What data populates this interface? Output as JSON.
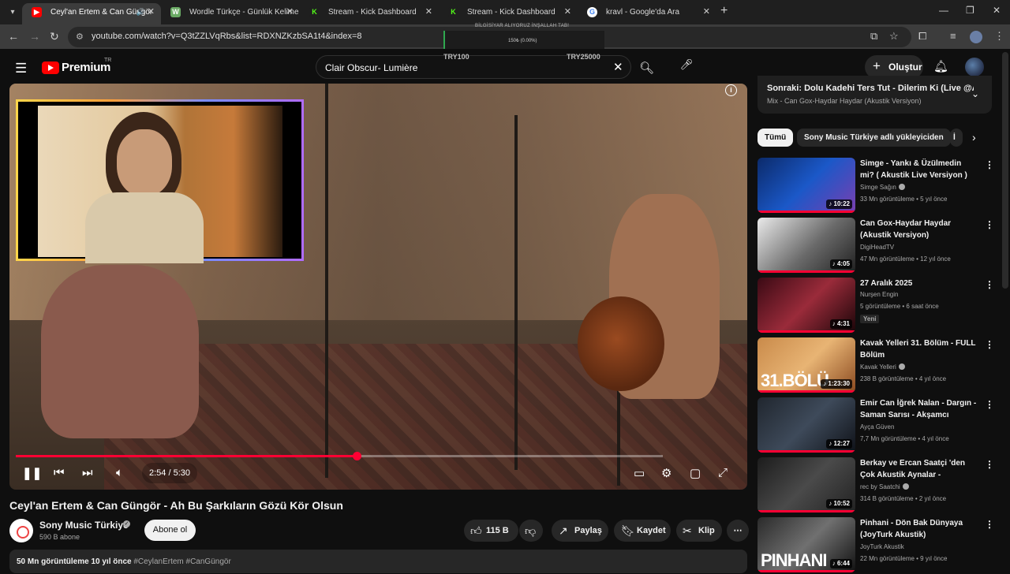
{
  "browser": {
    "tabs": [
      {
        "label": "Ceyl'an Ertem & Can Güngör",
        "favicon": "youtube-icon",
        "active": true
      },
      {
        "label": "Wordle Türkçe - Günlük Kelime",
        "favicon": "wordle-icon",
        "active": false
      },
      {
        "label": "Stream - Kick Dashboard",
        "favicon": "kick-icon",
        "active": false
      },
      {
        "label": "Stream - Kick Dashboard",
        "favicon": "kick-icon",
        "active": false
      },
      {
        "label": "kravl - Google'da Ara",
        "favicon": "google-icon",
        "active": false
      }
    ],
    "url": "youtube.com/watch?v=Q3tZZLVqRbs&list=RDXNZKzbSA1t4&index=8"
  },
  "stream_overlay": {
    "title": "BİLGİSİYAR ALIYORUZ İNŞALLAH TAB!",
    "progress_text": "150₺ (0.00%)",
    "progress": 0.0,
    "min_label": "TRY100",
    "max_label": "TRY25000"
  },
  "header": {
    "logo_text": "Premium",
    "logo_region": "TR",
    "search_value": "Clair Obscur- Lumière",
    "create_label": "Oluştur"
  },
  "player": {
    "time_text": "2:54 / 5:30",
    "progress": 0.527
  },
  "video": {
    "title": "Ceyl'an Ertem & Can Güngör - Ah Bu Şarkıların Gözü Kör Olsun",
    "channel": "Sony Music Türkiye",
    "subscribers": "590 B abone",
    "subscribe_label": "Abone ol",
    "likes": "115 B",
    "share_label": "Paylaş",
    "save_label": "Kaydet",
    "clip_label": "Klip",
    "desc_stats": "50 Mn görüntüleme  10 yıl önce",
    "desc_tags": "#CeylanErtem #CanGüngör"
  },
  "sidebar": {
    "next_title": "Sonraki: Dolu Kadehi Ters Tut - Dilerim Ki (Live @As...",
    "next_sub": "Mix - Can Gox-Haydar Haydar (Akustik Versiyon)",
    "chips": [
      "Tümü",
      "Sony Music Türkiye adlı yükleyiciden",
      "İ"
    ],
    "recommendations": [
      {
        "title": "Simge - Yankı & Üzülmedin mi? ( Akustik Live Versiyon )",
        "channel": "Simge Sağın",
        "verified": true,
        "meta": "33 Mn görüntüleme • 5 yıl önce",
        "duration": "10:22",
        "badge": ""
      },
      {
        "title": "Can Gox-Haydar Haydar (Akustik Versiyon)",
        "channel": "DigiHeadTV",
        "verified": false,
        "meta": "47 Mn görüntüleme • 12 yıl önce",
        "duration": "4:05",
        "badge": ""
      },
      {
        "title": "27 Aralık 2025",
        "channel": "Nurşen Engin",
        "verified": false,
        "meta": "5 görüntüleme • 6 saat önce",
        "duration": "4:31",
        "badge": "Yeni"
      },
      {
        "title": "Kavak Yelleri 31. Bölüm - FULL Bölüm",
        "channel": "Kavak Yelleri",
        "verified": true,
        "meta": "238 B görüntüleme • 4 yıl önce",
        "duration": "1:23:30",
        "badge": "",
        "thumb_text": "31.BÖLÜ"
      },
      {
        "title": "Emir Can İğrek Nalan - Dargın - Saman Sarısı - Akşamcı",
        "channel": "Ayça Güven",
        "verified": false,
        "meta": "7,7 Mn görüntüleme • 4 yıl önce",
        "duration": "12:27",
        "badge": ""
      },
      {
        "title": "Berkay ve Ercan Saatçi 'den Çok Akustik Aynalar - Sigaranın ...",
        "channel": "rec by Saatchi",
        "verified": true,
        "meta": "314 B görüntüleme • 2 yıl önce",
        "duration": "10:52",
        "badge": ""
      },
      {
        "title": "Pinhani - Dön Bak Dünyaya (JoyTurk Akustik)",
        "channel": "JoyTurk Akustik",
        "verified": false,
        "meta": "22 Mn görüntüleme • 9 yıl önce",
        "duration": "6:44",
        "badge": "",
        "thumb_text": "PINHANI"
      }
    ]
  },
  "colors": {
    "accent": "#ff0033",
    "background": "#0f0f0f",
    "surface": "#272727"
  }
}
